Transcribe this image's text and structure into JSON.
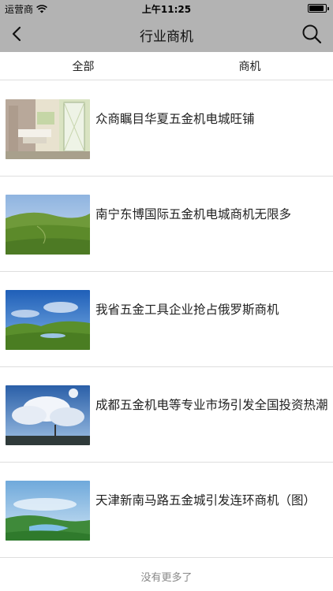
{
  "status_bar": {
    "carrier": "运营商",
    "time": "上午11:25"
  },
  "nav": {
    "title": "行业商机"
  },
  "tabs": [
    {
      "label": "全部"
    },
    {
      "label": "商机"
    }
  ],
  "items": [
    {
      "title": "众商瞩目华夏五金机电城旺铺"
    },
    {
      "title": "南宁东博国际五金机电城商机无限多"
    },
    {
      "title": "我省五金工具企业抢占俄罗斯商机"
    },
    {
      "title": "成都五金机电等专业市场引发全国投资热潮"
    },
    {
      "title": "天津新南马路五金城引发连环商机（图）"
    }
  ],
  "footer": {
    "text": "没有更多了"
  },
  "icons": {
    "back": "chevron-left-icon",
    "search": "search-icon",
    "wifi": "wifi-icon",
    "battery": "battery-icon"
  }
}
